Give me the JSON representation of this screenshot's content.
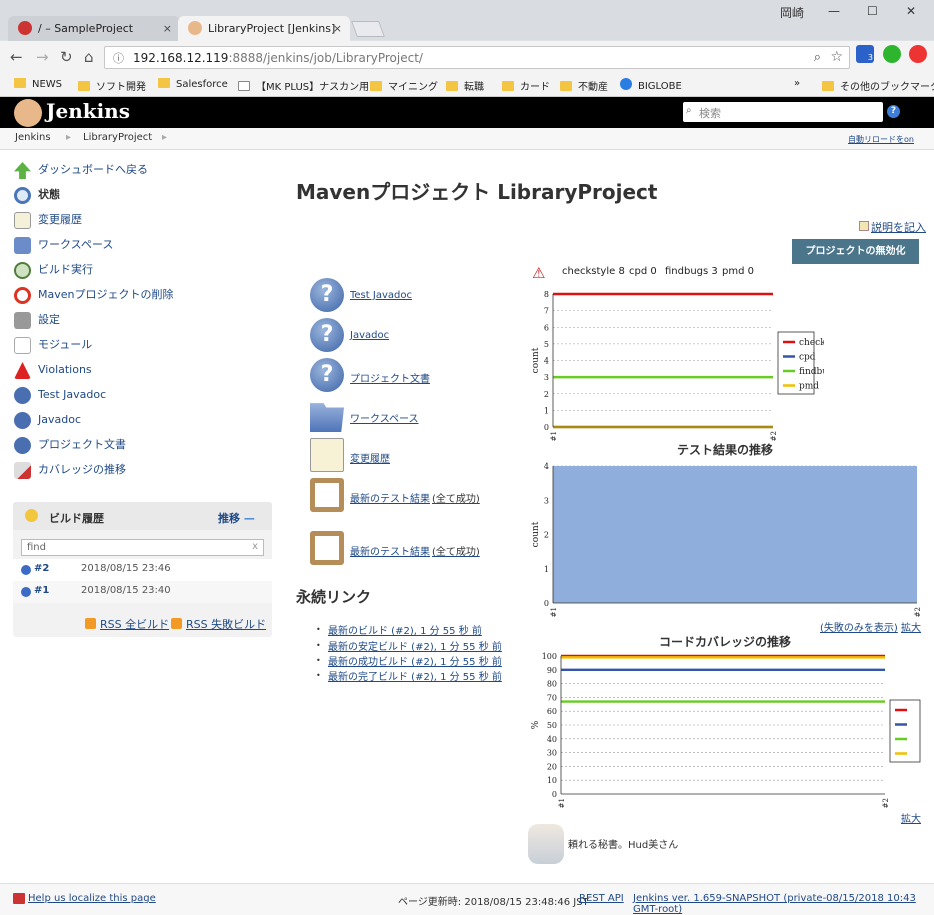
{
  "browser": {
    "tabs": [
      {
        "label": "/ – SampleProject",
        "close": "×"
      },
      {
        "label": "LibraryProject [Jenkins]",
        "close": "×"
      }
    ],
    "window_user": "岡崎",
    "window_controls": {
      "minimize": "—",
      "maximize": "☐",
      "close": "✕"
    },
    "url_host": "192.168.12.119",
    "url_rest": ":8888/jenkins/job/LibraryProject/",
    "bookmarks": [
      "NEWS",
      "ソフト開発",
      "Salesforce",
      "【MK PLUS】ナスカン用",
      "マイニング",
      "転職",
      "カード",
      "不動産",
      "BIGLOBE"
    ],
    "bookmarks_more": "»",
    "other_bookmarks": "その他のブックマーク",
    "ext_badge": "3"
  },
  "header": {
    "brand": "Jenkins",
    "search_placeholder": "検索"
  },
  "breadcrumbs": [
    "Jenkins",
    "LibraryProject"
  ],
  "auto_refresh": "自動リロードをon",
  "sidebar": {
    "items": [
      {
        "label": "ダッシュボードへ戻る",
        "icon": "up-arrow-icon"
      },
      {
        "label": "状態",
        "icon": "magnifier-icon"
      },
      {
        "label": "変更履歴",
        "icon": "notepad-icon"
      },
      {
        "label": "ワークスペース",
        "icon": "folder-icon"
      },
      {
        "label": "ビルド実行",
        "icon": "clock-icon"
      },
      {
        "label": "Mavenプロジェクトの削除",
        "icon": "no-entry-icon"
      },
      {
        "label": "設定",
        "icon": "tools-icon"
      },
      {
        "label": "モジュール",
        "icon": "document-icon"
      },
      {
        "label": "Violations",
        "icon": "warning-icon"
      },
      {
        "label": "Test Javadoc",
        "icon": "help-icon"
      },
      {
        "label": "Javadoc",
        "icon": "help-icon"
      },
      {
        "label": "プロジェクト文書",
        "icon": "help-icon"
      },
      {
        "label": "カバレッジの推移",
        "icon": "coverage-icon"
      }
    ]
  },
  "build_history": {
    "title": "ビルド履歴",
    "trend": "推移",
    "trend_dash": "—",
    "find_placeholder": "find",
    "find_clear": "x",
    "builds": [
      {
        "number": "#2",
        "date": "2018/08/15 23:46"
      },
      {
        "number": "#1",
        "date": "2018/08/15 23:40"
      }
    ],
    "rss_all": "RSS 全ビルド",
    "rss_fail": "RSS 失敗ビルド"
  },
  "main": {
    "title": "Mavenプロジェクト LibraryProject",
    "edit_description": "説明を記入",
    "disable_button": "プロジェクトの無効化",
    "links": [
      {
        "label": "Test Javadoc",
        "note": ""
      },
      {
        "label": "Javadoc",
        "note": ""
      },
      {
        "label": "プロジェクト文書",
        "note": ""
      },
      {
        "label": "ワークスペース",
        "note": ""
      },
      {
        "label": "変更履歴",
        "note": ""
      },
      {
        "label": "最新のテスト結果",
        "note": "(全て成功)"
      },
      {
        "label": "最新のテスト結果",
        "note": "(全て成功)"
      }
    ],
    "permalinks_title": "永続リンク",
    "permalinks": [
      "最新のビルド (#2), 1 分 55 秒 前",
      "最新の安定ビルド (#2), 1 分 55 秒 前",
      "最新の成功ビルド (#2), 1 分 55 秒 前",
      "最新の完了ビルド (#2), 1 分 55 秒 前"
    ],
    "violations_summary": [
      {
        "name": "checkstyle",
        "count": "8"
      },
      {
        "name": "cpd",
        "count": "0"
      },
      {
        "name": "findbugs",
        "count": "3"
      },
      {
        "name": "pmd",
        "count": "0"
      }
    ],
    "test_links": {
      "failed_only": "(失敗のみを表示)",
      "enlarge": "拡大"
    },
    "coverage_links": {
      "enlarge": "拡大"
    },
    "secretary": "頼れる秘書。Hud美さん"
  },
  "chart_data": [
    {
      "type": "line",
      "title": "",
      "ylabel": "count",
      "x": [
        "#1",
        "#2"
      ],
      "ylim": [
        0,
        8
      ],
      "yticks": [
        0,
        1,
        2,
        3,
        4,
        5,
        6,
        7,
        8
      ],
      "series": [
        {
          "name": "checkstyle",
          "color": "#dd1111",
          "values": [
            8,
            8
          ]
        },
        {
          "name": "cpd",
          "color": "#3355aa",
          "values": [
            0,
            0
          ]
        },
        {
          "name": "findbugs",
          "color": "#66cc22",
          "values": [
            3,
            3
          ]
        },
        {
          "name": "pmd",
          "color": "#f0c000",
          "values": [
            0,
            0
          ]
        }
      ],
      "legend": "right"
    },
    {
      "type": "area",
      "title": "テスト結果の推移",
      "ylabel": "count",
      "x": [
        "#1",
        "#2"
      ],
      "ylim": [
        0,
        4
      ],
      "yticks": [
        0,
        1,
        2,
        3,
        4
      ],
      "series": [
        {
          "name": "",
          "color": "#8faedb",
          "values": [
            4,
            4
          ]
        }
      ]
    },
    {
      "type": "line",
      "title": "コードカバレッジの推移",
      "ylabel": "%",
      "x": [
        "#1",
        "#2"
      ],
      "ylim": [
        0,
        100
      ],
      "yticks": [
        0,
        10,
        20,
        30,
        40,
        50,
        60,
        70,
        80,
        90,
        100
      ],
      "series": [
        {
          "name": "",
          "color": "#dd1111",
          "values": [
            100,
            100
          ]
        },
        {
          "name": "",
          "color": "#3355aa",
          "values": [
            90,
            90
          ]
        },
        {
          "name": "",
          "color": "#66cc22",
          "values": [
            67,
            67
          ]
        },
        {
          "name": "",
          "color": "#f0c000",
          "values": [
            99,
            99
          ]
        }
      ],
      "legend": "right"
    }
  ],
  "footer": {
    "localize": "Help us localize this page",
    "updated": "ページ更新時: 2018/08/15 23:48:46 JST",
    "rest_api": "REST API",
    "version": "Jenkins ver. 1.659-SNAPSHOT (private-08/15/2018 10:43 GMT-root)"
  }
}
